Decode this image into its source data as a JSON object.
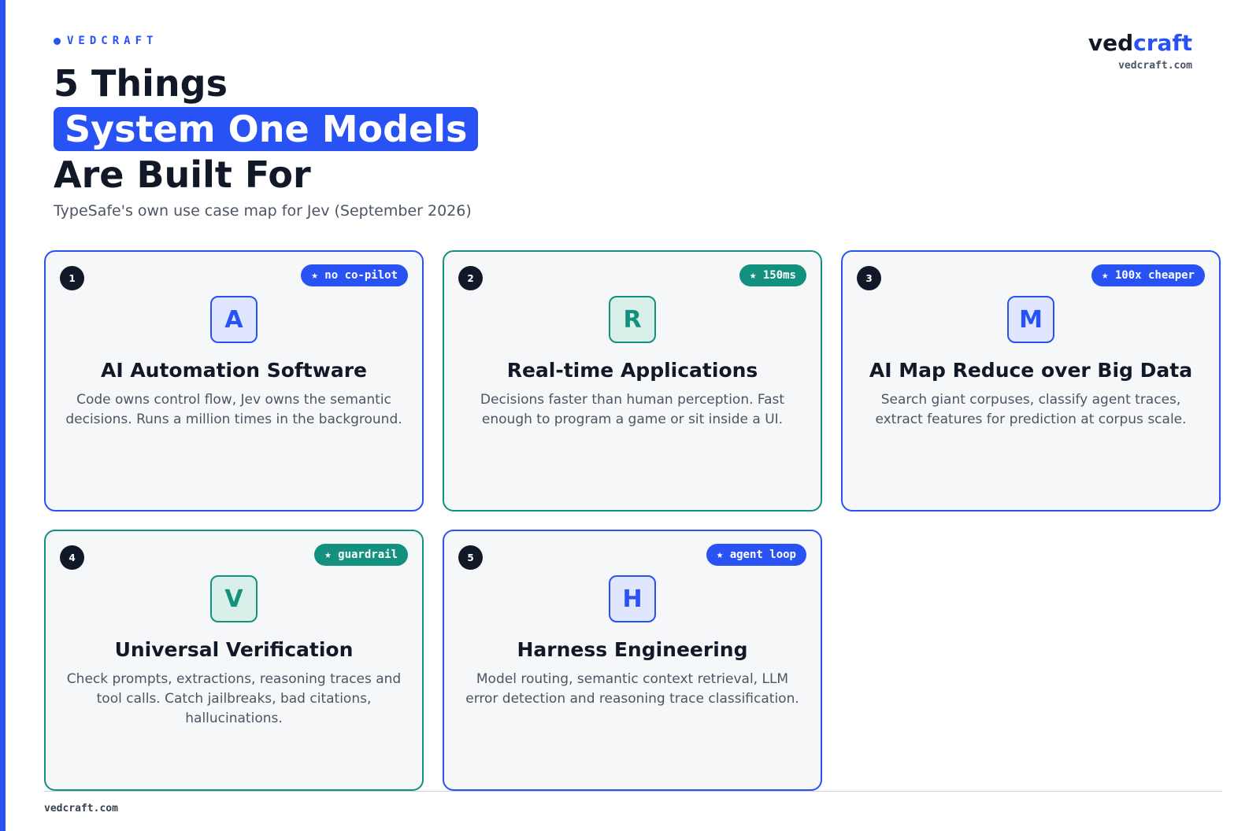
{
  "header": {
    "eyebrow": "VEDCRAFT",
    "title_line1": "5 Things",
    "title_highlight": "System One Models",
    "title_line3": "Are Built For",
    "subtitle": "TypeSafe's own use case map for Jev (September 2026)"
  },
  "brand": {
    "logo_part1": "ved",
    "logo_part2": "craft",
    "url": "vedcraft.com"
  },
  "cards": [
    {
      "number": "1",
      "badge": "★ no co-pilot",
      "letter": "A",
      "title": "AI Automation Software",
      "description": "Code owns control flow, Jev owns the semantic decisions. Runs a million times in the background."
    },
    {
      "number": "2",
      "badge": "★ 150ms",
      "letter": "R",
      "title": "Real-time Applications",
      "description": "Decisions faster than human perception. Fast enough to program a game or sit inside a UI."
    },
    {
      "number": "3",
      "badge": "★ 100x cheaper",
      "letter": "M",
      "title": "AI Map Reduce over Big Data",
      "description": "Search giant corpuses, classify agent traces, extract features for prediction at corpus scale."
    },
    {
      "number": "4",
      "badge": "★ guardrail",
      "letter": "V",
      "title": "Universal Verification",
      "description": "Check prompts, extractions, reasoning traces and tool calls. Catch jailbreaks, bad citations, hallucinations."
    },
    {
      "number": "5",
      "badge": "★ agent loop",
      "letter": "H",
      "title": "Harness Engineering",
      "description": "Model routing, semantic context retrieval, LLM error detection and reasoning trace classification."
    }
  ],
  "footer": {
    "text": "vedcraft.com"
  },
  "colors": {
    "accent_blue": "#2952f5",
    "accent_teal": "#14917e",
    "text_dark": "#111827",
    "text_muted": "#4b5563"
  }
}
